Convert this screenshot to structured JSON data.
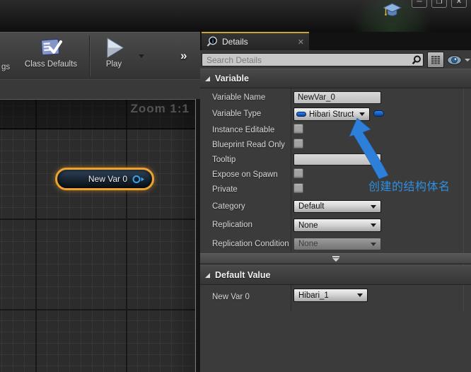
{
  "window": {
    "controls": {
      "minimize": "─",
      "maximize": "❐",
      "close": "✕"
    }
  },
  "toolbar": {
    "clipped_label": "gs",
    "class_defaults_label": "Class Defaults",
    "play_label": "Play",
    "overflow_chevron": "»"
  },
  "graph": {
    "zoom_indicator": "Zoom 1:1",
    "node_label": "New Var 0"
  },
  "details": {
    "tab_label": "Details",
    "tab_close": "✕",
    "search_placeholder": "Search Details",
    "sections": {
      "variable": "Variable",
      "default_value": "Default Value"
    },
    "rows": {
      "variable_name": {
        "label": "Variable Name",
        "value": "NewVar_0"
      },
      "variable_type": {
        "label": "Variable Type",
        "value": "Hibari Struct"
      },
      "instance_editable": {
        "label": "Instance Editable",
        "checked": false
      },
      "blueprint_read_only": {
        "label": "Blueprint Read Only",
        "checked": false
      },
      "tooltip": {
        "label": "Tooltip",
        "value": ""
      },
      "expose_on_spawn": {
        "label": "Expose on Spawn",
        "checked": false
      },
      "private": {
        "label": "Private",
        "checked": false
      },
      "category": {
        "label": "Category",
        "value": "Default"
      },
      "replication": {
        "label": "Replication",
        "value": "None"
      },
      "replication_condition": {
        "label": "Replication Condition",
        "value": "None",
        "disabled": true
      },
      "default_new_var": {
        "label": "New Var 0",
        "value": "Hibari_1"
      }
    }
  },
  "annotation": {
    "text": "创建的结构体名",
    "color": "#2e8fe0"
  },
  "colors": {
    "tab_accent_yellow": "#c9a634",
    "node_selection_orange": "#efa22f",
    "struct_pill_blue": "#1c64c8",
    "pin_blue": "#3aa2e8",
    "annotation_blue": "#2e8fe0",
    "panel_bg": "#3b3b3b",
    "graph_bg": "#2c2c2c"
  },
  "icons": {
    "graduation_cap": "tutorial mortarboard",
    "details_tab": "magnifier with i",
    "search": "magnifier",
    "grid_view": "property matrix grid",
    "eye": "visibility filter",
    "play": "triangle",
    "class_defaults": "checklist board",
    "struct_pill": "blue capsule",
    "output_pin": "circle with arrow"
  }
}
